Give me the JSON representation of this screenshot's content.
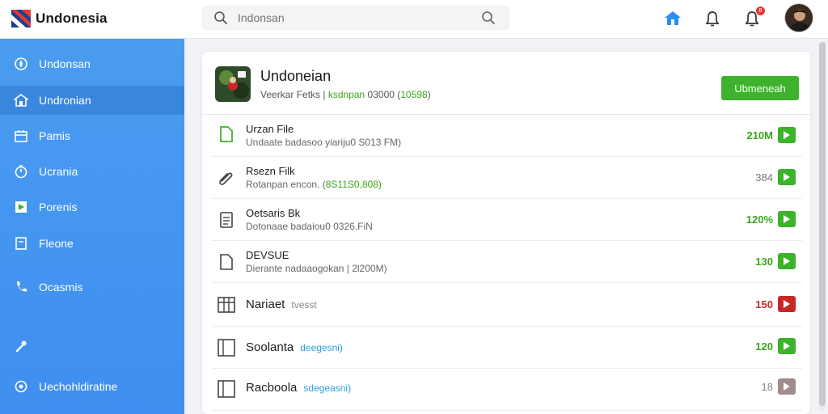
{
  "header": {
    "brand": "Undonesia",
    "search_placeholder": "Indonsan",
    "notification_count": "8"
  },
  "sidebar": {
    "items": [
      {
        "label": "Undonsan",
        "icon": "compass-icon"
      },
      {
        "label": "Undronian",
        "icon": "home-icon"
      },
      {
        "label": "Pamis",
        "icon": "calendar-icon"
      },
      {
        "label": "Ucrania",
        "icon": "clock-icon"
      },
      {
        "label": "Porenis",
        "icon": "play-icon"
      },
      {
        "label": "Fleone",
        "icon": "square-icon"
      },
      {
        "label": "Ocasmis",
        "icon": "phone-icon"
      },
      {
        "label": "",
        "icon": "wrench-icon"
      },
      {
        "label": "Uechohldiratine",
        "icon": "gear-icon"
      }
    ],
    "active_index": 1
  },
  "app": {
    "title": "Undoneian",
    "subtitle_prefix": "Veerkar Fetks |",
    "subtitle_highlight": "ksdnpan",
    "subtitle_mid": "03000 (",
    "subtitle_highlight2": "10598",
    "subtitle_end": ")",
    "primary_button": "Ubmeneah"
  },
  "rows": [
    {
      "title": "Urzan File",
      "sub": "Undaate badasoo yiariju0 S013 FM)",
      "sub_hl": "",
      "value": "210M",
      "value_color": "#3aa51c",
      "arrow_color": "#3cb32a",
      "icon": "file-icon"
    },
    {
      "title": "Rsezn Filk",
      "sub": "Rotanpan encon. (",
      "sub_hl": "8S11S0,808)",
      "value": "384",
      "value_color": "#777777",
      "arrow_color": "#3cb32a",
      "icon": "paperclip-icon"
    },
    {
      "title": "Oetsaris Bk",
      "sub": "Dotonaae badaiou0 0326.FiN",
      "sub_hl": "",
      "value": "120%",
      "value_color": "#3aa51c",
      "arrow_color": "#3cb32a",
      "icon": "document-icon"
    },
    {
      "title": "DEVSUE",
      "sub": "Dierante nadaaogokan | 2l200M)",
      "sub_hl": "",
      "value": "130",
      "value_color": "#3aa51c",
      "arrow_color": "#3cb32a",
      "icon": "page-icon"
    },
    {
      "title": "Nariaet",
      "inline_sub": "tvesst",
      "inline_color": "#888888",
      "value": "150",
      "value_color": "#c62828",
      "arrow_color": "#c62828",
      "icon": "grid-icon"
    },
    {
      "title": "Soolanta",
      "inline_sub": "deegesni)",
      "inline_color": "#2a9fd6",
      "value": "120",
      "value_color": "#3aa51c",
      "arrow_color": "#3cb32a",
      "icon": "panel-icon"
    },
    {
      "title": "Racboola",
      "inline_sub": "sdegeasni)",
      "inline_color": "#2a9fd6",
      "value": "18",
      "value_color": "#888888",
      "arrow_color": "#a08a8a",
      "icon": "panel-icon"
    }
  ],
  "colors": {
    "sidebar": "#4a9cf0",
    "accent_green": "#3cb32a",
    "danger": "#c62828"
  }
}
